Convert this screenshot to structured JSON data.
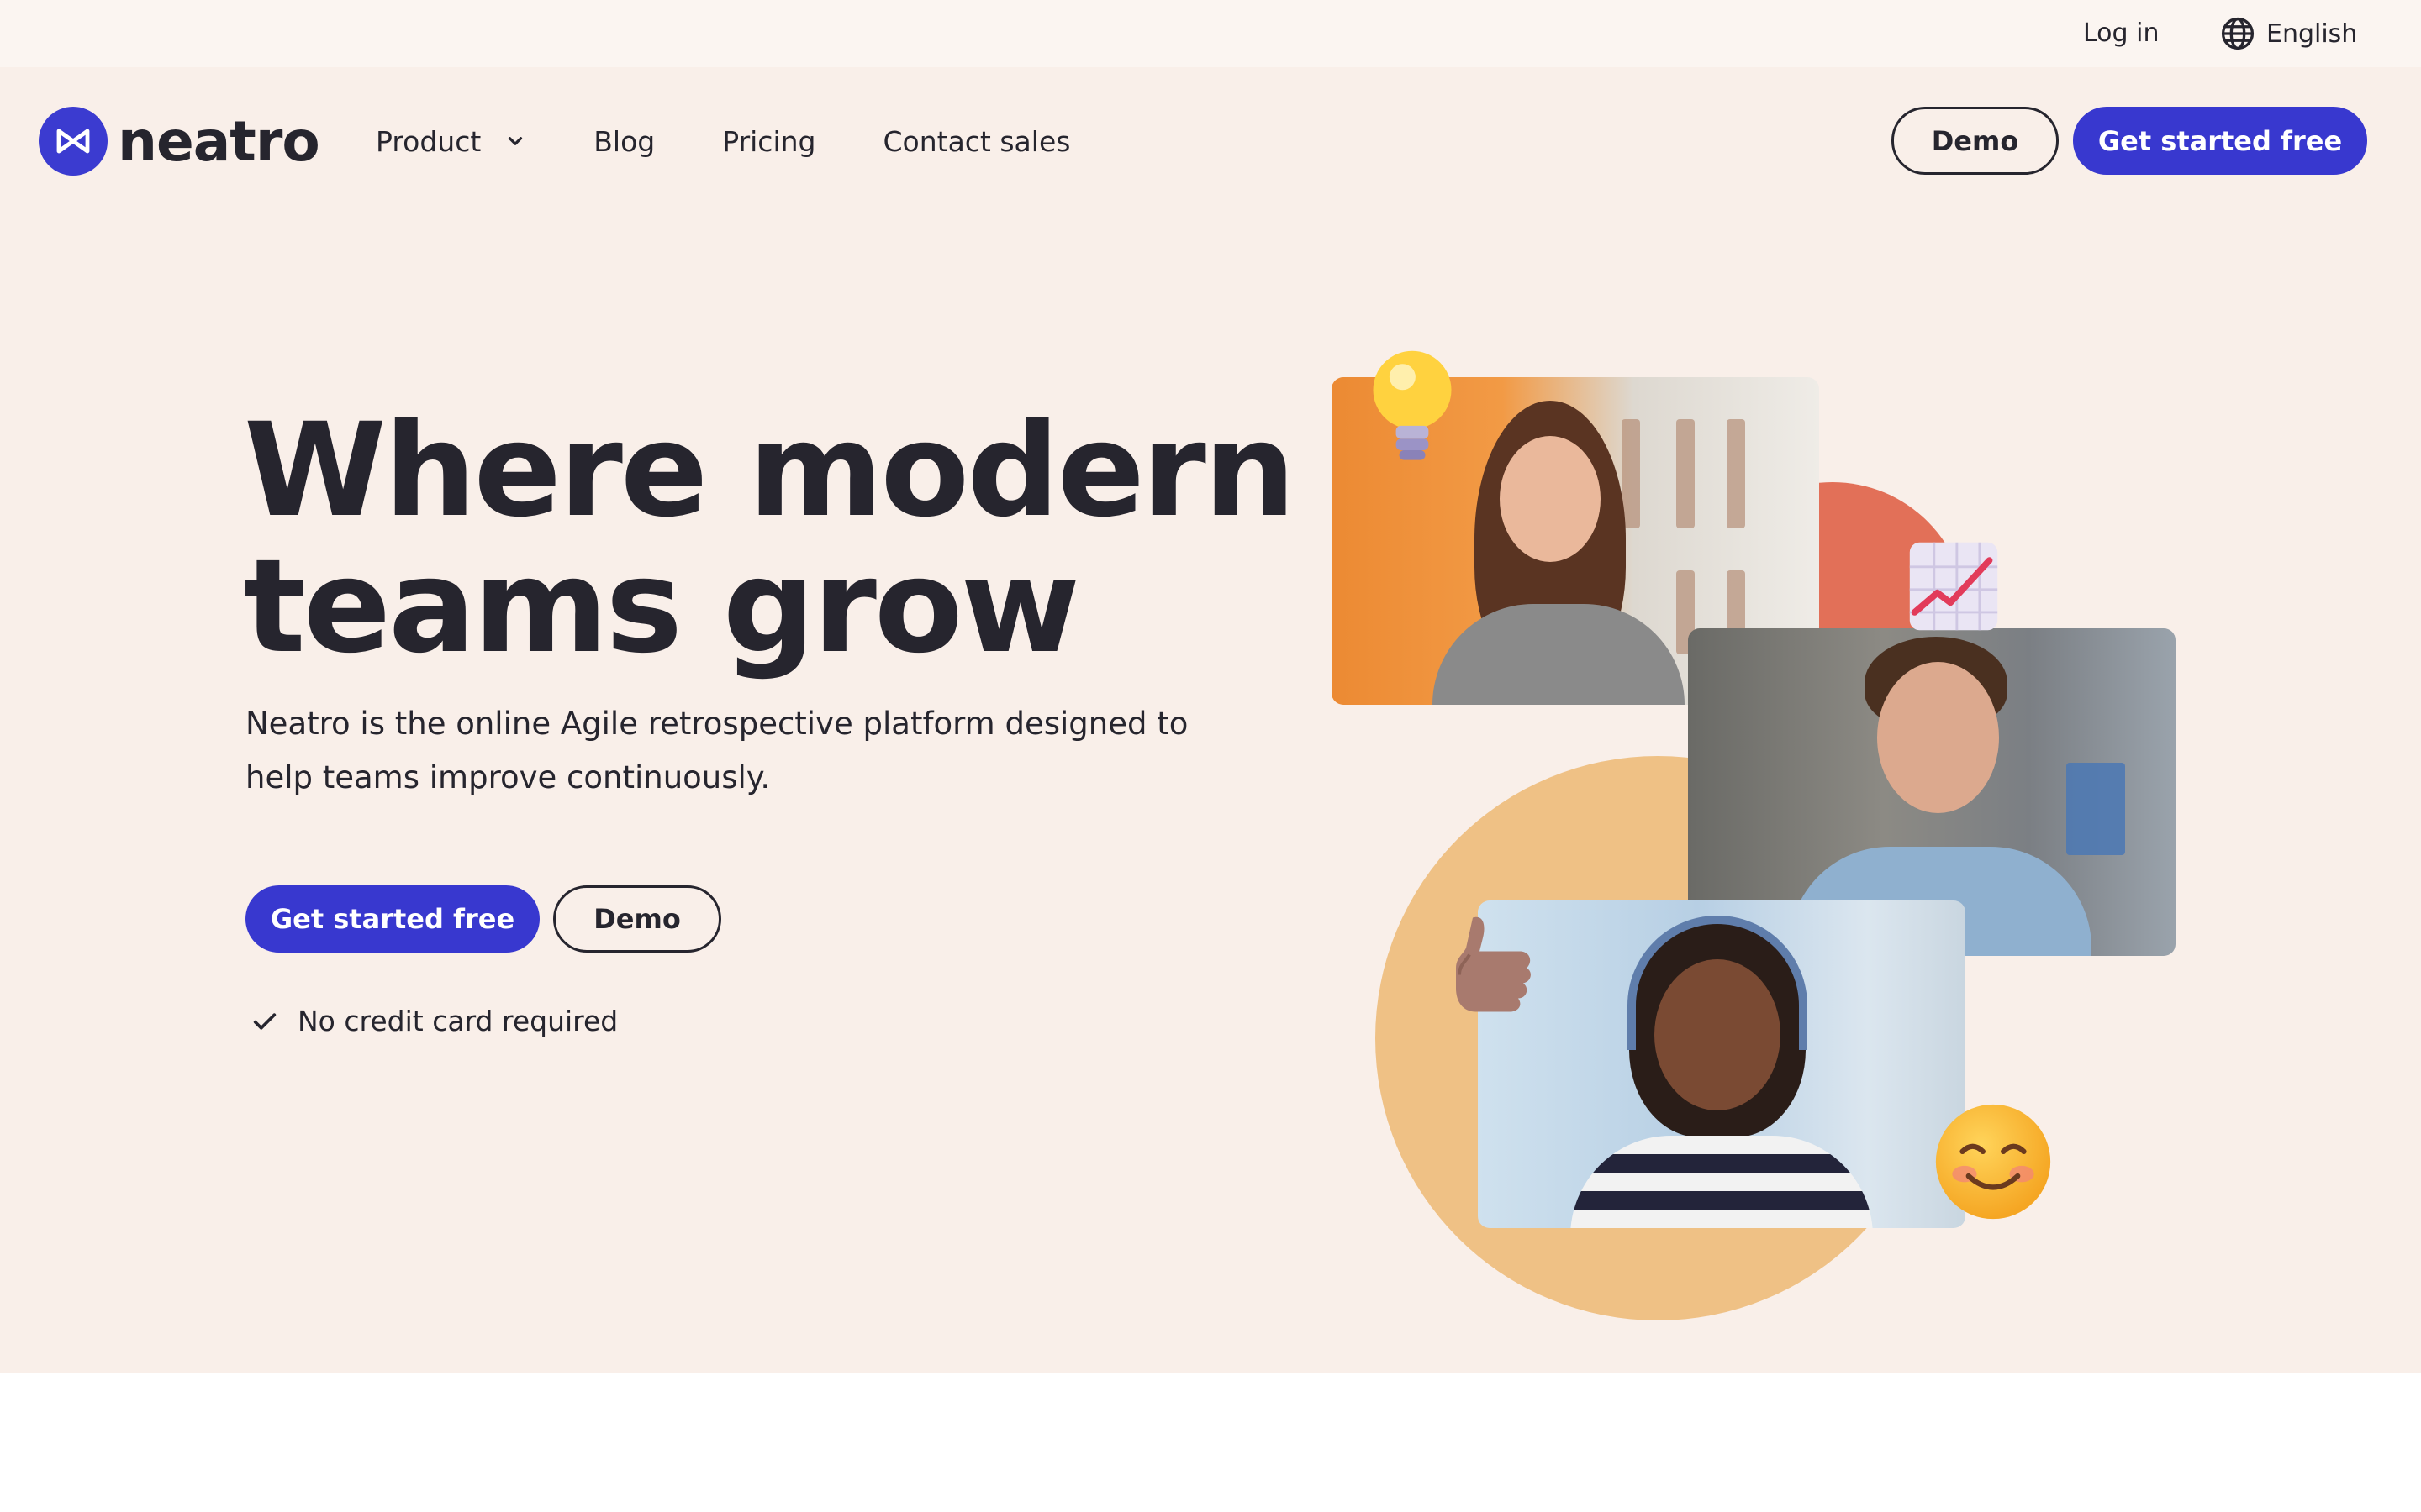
{
  "utility": {
    "login_label": "Log in",
    "language_label": "English"
  },
  "nav": {
    "logo_text": "neatro",
    "items": [
      {
        "label": "Product"
      },
      {
        "label": "Blog"
      },
      {
        "label": "Pricing"
      },
      {
        "label": "Contact sales"
      }
    ],
    "demo_label": "Demo",
    "start_label": "Get started free"
  },
  "hero": {
    "headline_line1": "Where modern",
    "headline_line2": "teams grow",
    "subtext_line1": "Neatro is the online Agile retrospective platform designed to",
    "subtext_line2": "help teams improve continuously.",
    "start_label": "Get started free",
    "demo_label": "Demo",
    "note": "No credit card required"
  },
  "colors": {
    "brand": "#3838cf",
    "hero_bg": "#f9efe9",
    "utility_bg": "#fbf5f1",
    "text": "#26252e",
    "circle_orange": "#efc185",
    "circle_coral": "#e27058"
  },
  "icons": [
    "globe-icon",
    "chevron-down-icon",
    "check-icon",
    "lightbulb-emoji",
    "chart-emoji",
    "thumbs-up-emoji",
    "smiling-face-emoji"
  ]
}
